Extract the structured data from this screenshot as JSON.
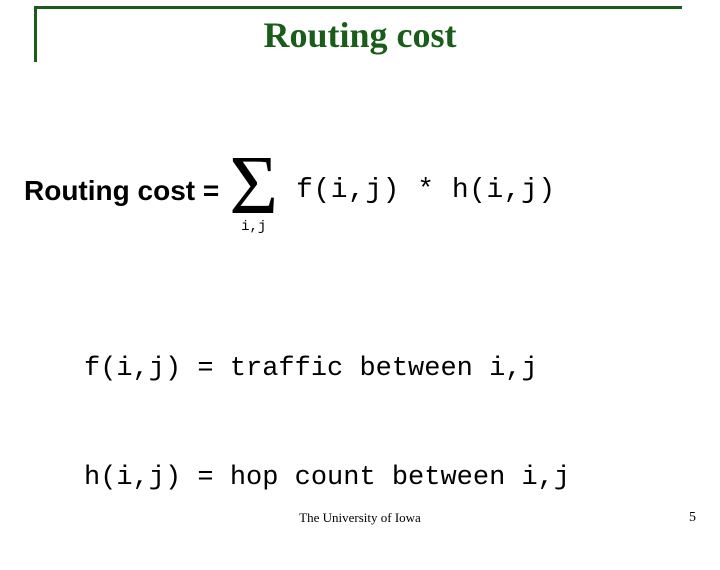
{
  "title": "Routing cost",
  "formula": {
    "lhs": "Routing cost =",
    "sigma": "Σ",
    "sigma_sub": "i,j",
    "rhs": "f(i,j) * h(i,j)"
  },
  "defs": {
    "line1": "f(i,j) = traffic between i,j",
    "line2": "h(i,j) = hop count between i,j"
  },
  "footer": {
    "center": "The University of Iowa",
    "pagenum": "5"
  }
}
